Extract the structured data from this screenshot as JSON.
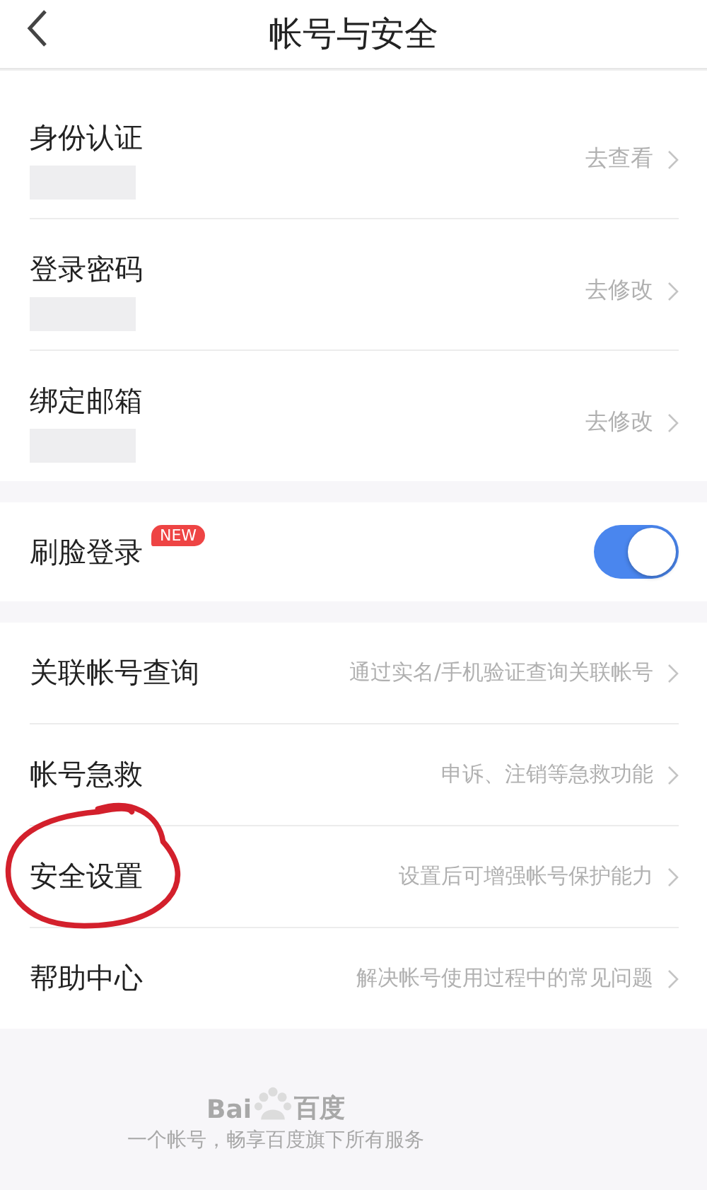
{
  "header": {
    "title": "帐号与安全"
  },
  "groups": [
    {
      "rows": [
        {
          "kind": "link",
          "label": "身份认证",
          "detail": "去查看",
          "masked": true
        },
        {
          "kind": "link",
          "label": "登录密码",
          "detail": "去修改",
          "masked": true
        },
        {
          "kind": "link",
          "label": "绑定邮箱",
          "detail": "去修改",
          "masked": true
        }
      ]
    },
    {
      "rows": [
        {
          "kind": "toggle",
          "label": "刷脸登录",
          "badge": "NEW",
          "on": true
        }
      ]
    },
    {
      "rows": [
        {
          "kind": "link",
          "label": "关联帐号查询",
          "detail": "通过实名/手机验证查询关联帐号"
        },
        {
          "kind": "link",
          "label": "帐号急救",
          "detail": "申诉、注销等急救功能"
        },
        {
          "kind": "link",
          "label": "安全设置",
          "detail": "设置后可增强帐号保护能力",
          "circled": true
        },
        {
          "kind": "link",
          "label": "帮助中心",
          "detail": "解决帐号使用过程中的常见问题"
        }
      ]
    }
  ],
  "footer": {
    "logo_left": "Bai",
    "logo_right": "百度",
    "slogan": "一个帐号，畅享百度旗下所有服务"
  }
}
